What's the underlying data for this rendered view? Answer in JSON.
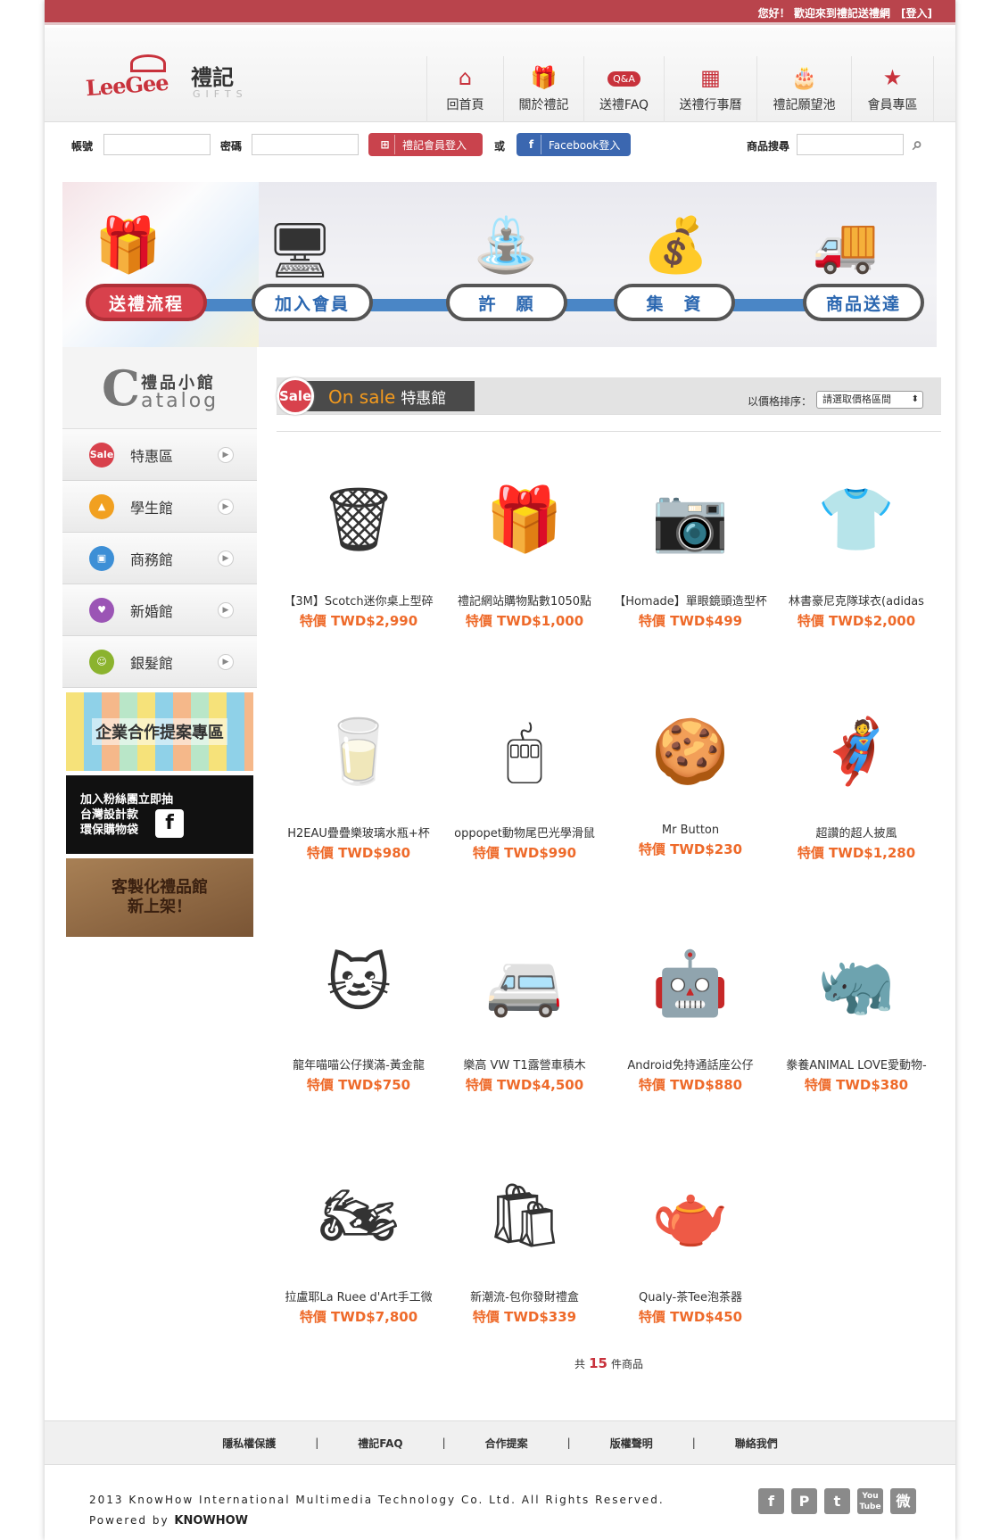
{
  "topbar": {
    "welcome": "您好！ 歡迎來到禮記送禮網",
    "login": "[登入]"
  },
  "logo": {
    "brand": "LeeGee",
    "chinese": "禮記",
    "sub": "GIFTS"
  },
  "nav": [
    {
      "label": "回首頁",
      "icon": "home-icon"
    },
    {
      "label": "關於禮記",
      "icon": "gift-icon"
    },
    {
      "label": "送禮FAQ",
      "icon": "qa-icon",
      "badge": "Q&A"
    },
    {
      "label": "送禮行事曆",
      "icon": "calendar-icon"
    },
    {
      "label": "禮記願望池",
      "icon": "wish-icon"
    },
    {
      "label": "會員專區",
      "icon": "star-icon"
    }
  ],
  "login": {
    "account_label": "帳號",
    "password_label": "密碼",
    "member_btn": "禮記會員登入",
    "or": "或",
    "fb_btn": "Facebook登入",
    "search_label": "商品搜尋"
  },
  "banner": {
    "steps": [
      "送禮流程",
      "加入會員",
      "許　願",
      "集　資",
      "商品送達"
    ]
  },
  "catalog": {
    "title": "禮品小館",
    "letter": "C",
    "word": "atalog"
  },
  "sidebar": [
    {
      "label": "特惠區",
      "icon": "sale-icon",
      "badge": "Sale",
      "color": "#d8414c"
    },
    {
      "label": "學生館",
      "icon": "graduation-cap-icon",
      "badge": "",
      "color": "#f1a020"
    },
    {
      "label": "商務館",
      "icon": "briefcase-icon",
      "badge": "",
      "color": "#3d8fd6"
    },
    {
      "label": "新婚館",
      "icon": "heart-home-icon",
      "badge": "",
      "color": "#9b55b5"
    },
    {
      "label": "銀髮館",
      "icon": "elder-icon",
      "badge": "",
      "color": "#8bb32e"
    }
  ],
  "promos": {
    "corp": "企業合作提案專區",
    "fans_1": "加入粉絲團立即抽",
    "fans_2": "台灣設計款",
    "fans_3": "環保購物袋",
    "custom_1": "客製化禮品館",
    "custom_2": "新上架！"
  },
  "sale": {
    "badge": "Sale",
    "title": "On sale",
    "subtitle": "特惠館",
    "sort_label": "以價格排序：",
    "sort_value": "請選取價格區間"
  },
  "products": [
    {
      "name": "【3M】Scotch迷你桌上型碎",
      "price": "特價 TWD$2,990",
      "icon": "shredder-icon"
    },
    {
      "name": "禮記網站購物點數1050點",
      "price": "特價 TWD$1,000",
      "icon": "gift-card-icon"
    },
    {
      "name": "【Homade】單眼鏡頭造型杯",
      "price": "特價 TWD$499",
      "icon": "lens-cup-icon"
    },
    {
      "name": "林書豪尼克隊球衣(adidas",
      "price": "特價 TWD$2,000",
      "icon": "jersey-icon"
    },
    {
      "name": "H2EAU疊疊樂玻璃水瓶+杯",
      "price": "特價 TWD$980",
      "icon": "glass-icon"
    },
    {
      "name": "oppopet動物尾巴光學滑鼠",
      "price": "特價 TWD$990",
      "icon": "mouse-icon"
    },
    {
      "name": "Mr Button",
      "price": "特價 TWD$230",
      "icon": "button-icon"
    },
    {
      "name": "超讚的超人披風",
      "price": "特價 TWD$1,280",
      "icon": "superman-icon"
    },
    {
      "name": "龍年喵喵公仔撲滿-黃金龍",
      "price": "特價 TWD$750",
      "icon": "cat-figure-icon"
    },
    {
      "name": "樂高 VW T1露營車積木",
      "price": "特價 TWD$4,500",
      "icon": "van-icon"
    },
    {
      "name": "Android免持通話座公仔",
      "price": "特價 TWD$880",
      "icon": "android-icon"
    },
    {
      "name": "豢養ANIMAL LOVE愛動物-",
      "price": "特價 TWD$380",
      "icon": "rhino-planter-icon"
    },
    {
      "name": "拉盧耶La Ruee d'Art手工微",
      "price": "特價 TWD$7,800",
      "icon": "diorama-icon"
    },
    {
      "name": "新潮流-包你發財禮盒",
      "price": "特價 TWD$339",
      "icon": "gift-box-icon"
    },
    {
      "name": "Qualy-茶Tee泡茶器",
      "price": "特價 TWD$450",
      "icon": "tea-infuser-icon"
    }
  ],
  "count": {
    "pre": "共",
    "num": "15",
    "post": "件商品"
  },
  "footer": {
    "links": [
      "隱私權保護",
      "禮記FAQ",
      "合作提案",
      "版權聲明",
      "聯絡我們"
    ],
    "sep": "|",
    "copyright": "2013 KnowHow International Multimedia Technology Co. Ltd. All Rights Reserved.",
    "powered": "Powered by",
    "kh": "KNOWHOW"
  },
  "social": [
    "f",
    "P",
    "t",
    "You Tube",
    "微"
  ]
}
